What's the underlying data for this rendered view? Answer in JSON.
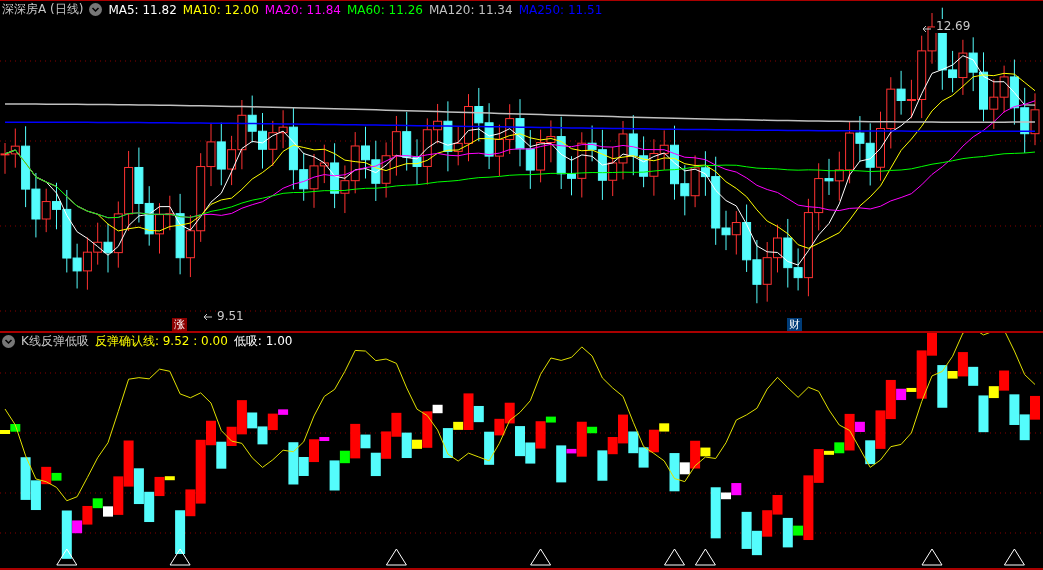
{
  "main_panel": {
    "title": "深深房A (日线)",
    "moving_averages": [
      {
        "label": "MA5: 11.82",
        "color": "#ffffff"
      },
      {
        "label": "MA10: 12.00",
        "color": "#ffff00"
      },
      {
        "label": "MA20: 11.84",
        "color": "#ff00ff"
      },
      {
        "label": "MA60: 11.26",
        "color": "#00ff00"
      },
      {
        "label": "MA120: 11.34",
        "color": "#c0c0c0"
      },
      {
        "label": "MA250: 11.51",
        "color": "#0000ff"
      }
    ],
    "high_label": "12.69",
    "low_label": "9.51",
    "markers": [
      {
        "text": "涨",
        "color": "#8b0000"
      },
      {
        "text": "财",
        "color": "#003c78"
      }
    ]
  },
  "indicator_panel": {
    "title": "K线反弹低吸",
    "values": [
      {
        "label": "反弹确认线: 9.52 : 0.00",
        "color": "#ffff00"
      },
      {
        "label": "低吸: 1.00",
        "color": "#ffffff"
      }
    ]
  }
}
